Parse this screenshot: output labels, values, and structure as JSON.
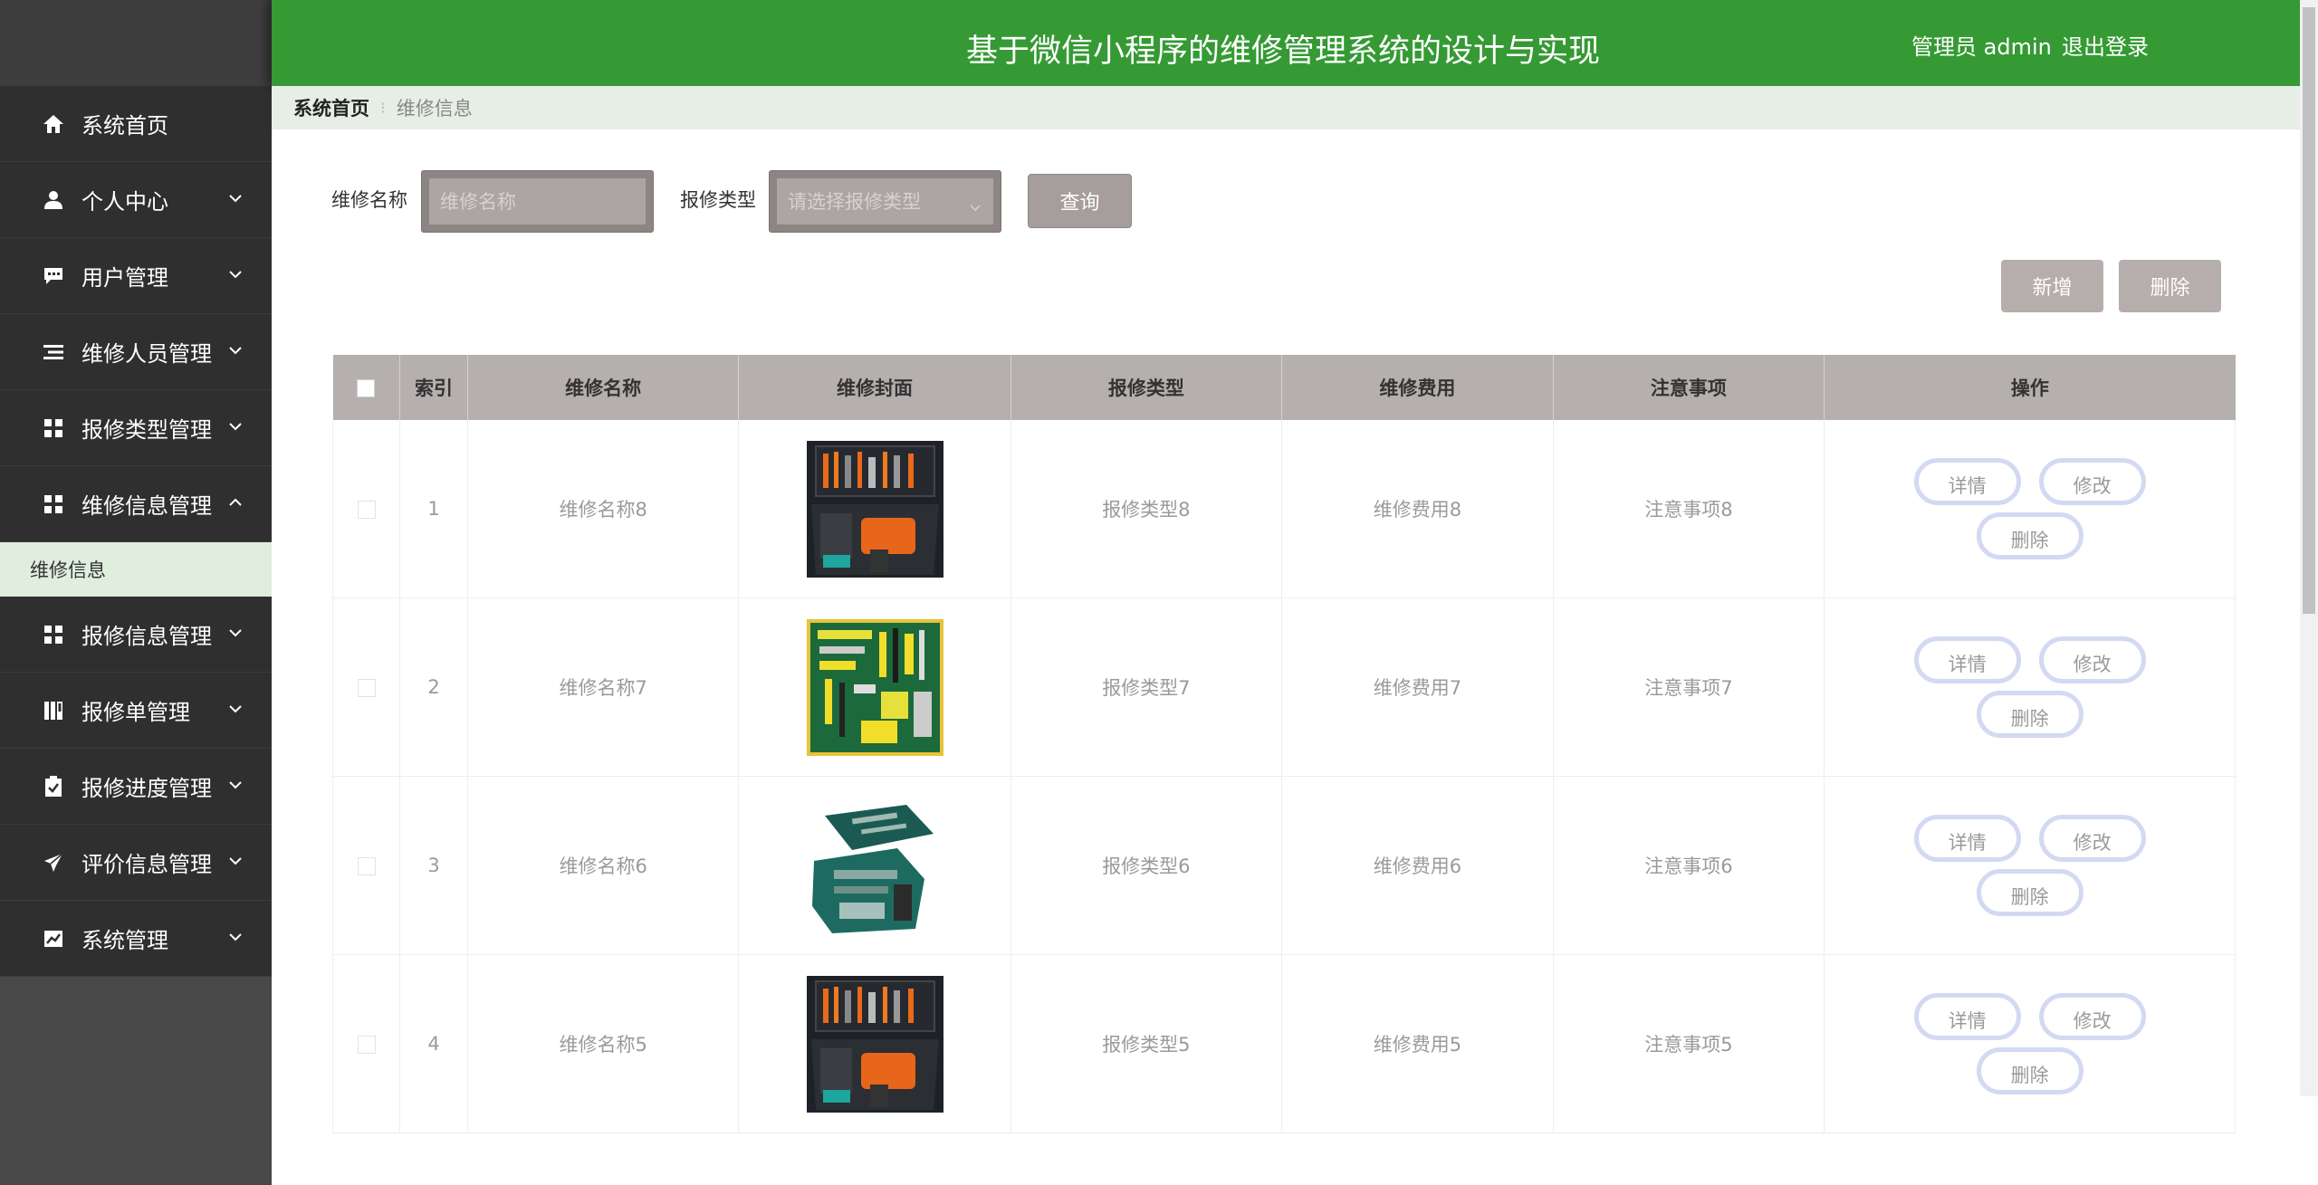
{
  "header": {
    "title": "基于微信小程序的维修管理系统的设计与实现",
    "user": "管理员 admin",
    "logout": "退出登录"
  },
  "sidebar": {
    "items": [
      {
        "label": "系统首页",
        "icon": "home-icon"
      },
      {
        "label": "个人中心",
        "icon": "user-icon"
      },
      {
        "label": "用户管理",
        "icon": "chat-icon"
      },
      {
        "label": "维修人员管理",
        "icon": "list-icon"
      },
      {
        "label": "报修类型管理",
        "icon": "grid-icon"
      },
      {
        "label": "维修信息管理",
        "icon": "grid-icon",
        "expanded": true
      },
      {
        "label": "报修信息管理",
        "icon": "grid-icon"
      },
      {
        "label": "报修单管理",
        "icon": "columns-icon"
      },
      {
        "label": "报修进度管理",
        "icon": "clipboard-check-icon"
      },
      {
        "label": "评价信息管理",
        "icon": "send-icon"
      },
      {
        "label": "系统管理",
        "icon": "chart-icon"
      }
    ],
    "active_sub": "维修信息"
  },
  "breadcrumb": {
    "home": "系统首页",
    "current": "维修信息"
  },
  "search": {
    "name_label": "维修名称",
    "name_placeholder": "维修名称",
    "type_label": "报修类型",
    "type_placeholder": "请选择报修类型",
    "query_button": "查询"
  },
  "actions": {
    "add": "新增",
    "delete": "删除"
  },
  "table": {
    "columns": [
      "索引",
      "维修名称",
      "维修封面",
      "报修类型",
      "维修费用",
      "注意事项",
      "操作"
    ],
    "rows": [
      {
        "index": "1",
        "name": "维修名称8",
        "type": "报修类型8",
        "fee": "维修费用8",
        "notes": "注意事项8",
        "cover": "orange-toolbox"
      },
      {
        "index": "2",
        "name": "维修名称7",
        "type": "报修类型7",
        "fee": "维修费用7",
        "notes": "注意事项7",
        "cover": "green-tool-set"
      },
      {
        "index": "3",
        "name": "维修名称6",
        "type": "报修类型6",
        "fee": "维修费用6",
        "notes": "注意事项6",
        "cover": "teal-tool-case"
      },
      {
        "index": "4",
        "name": "维修名称5",
        "type": "报修类型5",
        "fee": "维修费用5",
        "notes": "注意事项5",
        "cover": "orange-toolbox"
      }
    ],
    "row_buttons": {
      "detail": "详情",
      "edit": "修改",
      "delete": "删除"
    }
  },
  "colors": {
    "header_green": "#359a34",
    "sidebar_dark": "#2f2f2f",
    "sub_active_bg": "#dfeedd",
    "table_header": "#b5afae",
    "op_border": "#d4d9f3"
  }
}
